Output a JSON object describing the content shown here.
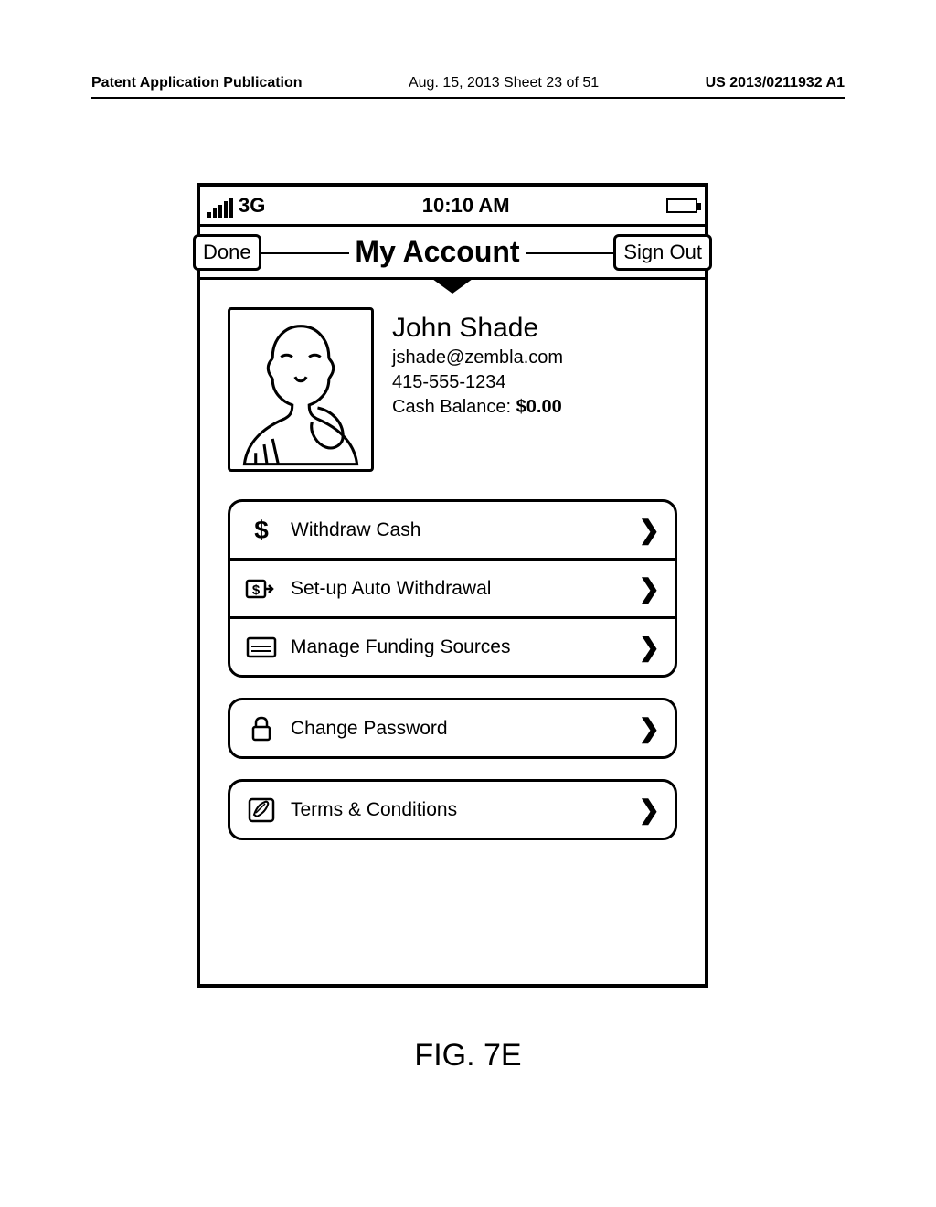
{
  "header": {
    "left": "Patent Application Publication",
    "center": "Aug. 15, 2013  Sheet 23 of 51",
    "right": "US 2013/0211932 A1"
  },
  "status": {
    "network": "3G",
    "time": "10:10 AM"
  },
  "nav": {
    "left_button": "Done",
    "title": "My Account",
    "right_button": "Sign Out"
  },
  "profile": {
    "name": "John Shade",
    "email": "jshade@zembla.com",
    "phone": "415-555-1234",
    "balance_label": "Cash Balance: ",
    "balance_amount": "$0.00"
  },
  "menu": {
    "group1": [
      {
        "icon": "dollar",
        "label": "Withdraw Cash"
      },
      {
        "icon": "auto",
        "label": "Set-up Auto Withdrawal"
      },
      {
        "icon": "card",
        "label": "Manage Funding Sources"
      }
    ],
    "group2": [
      {
        "icon": "lock",
        "label": "Change Password"
      }
    ],
    "group3": [
      {
        "icon": "clip",
        "label": "Terms & Conditions"
      }
    ]
  },
  "figure_label": "FIG. 7E"
}
